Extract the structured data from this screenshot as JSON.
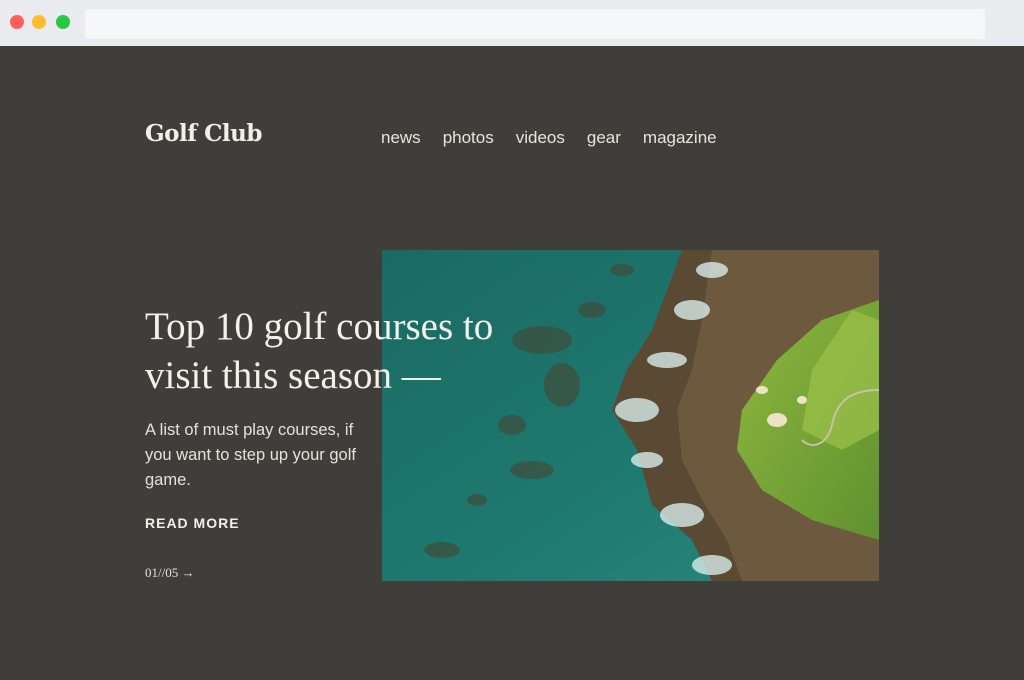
{
  "brand": {
    "name": "Golf Club"
  },
  "nav": {
    "items": [
      "news",
      "photos",
      "videos",
      "gear",
      "magazine"
    ]
  },
  "hero": {
    "headline": "Top 10 golf courses to visit this season —",
    "description": "A list of must play courses, if you want to step up your golf game.",
    "cta": "READ MORE",
    "pager": "01//05 →"
  },
  "colors": {
    "background": "#403e3a",
    "text": "#f4f1ea",
    "ocean": "#1f6e66",
    "grass": "#7aa53a"
  }
}
